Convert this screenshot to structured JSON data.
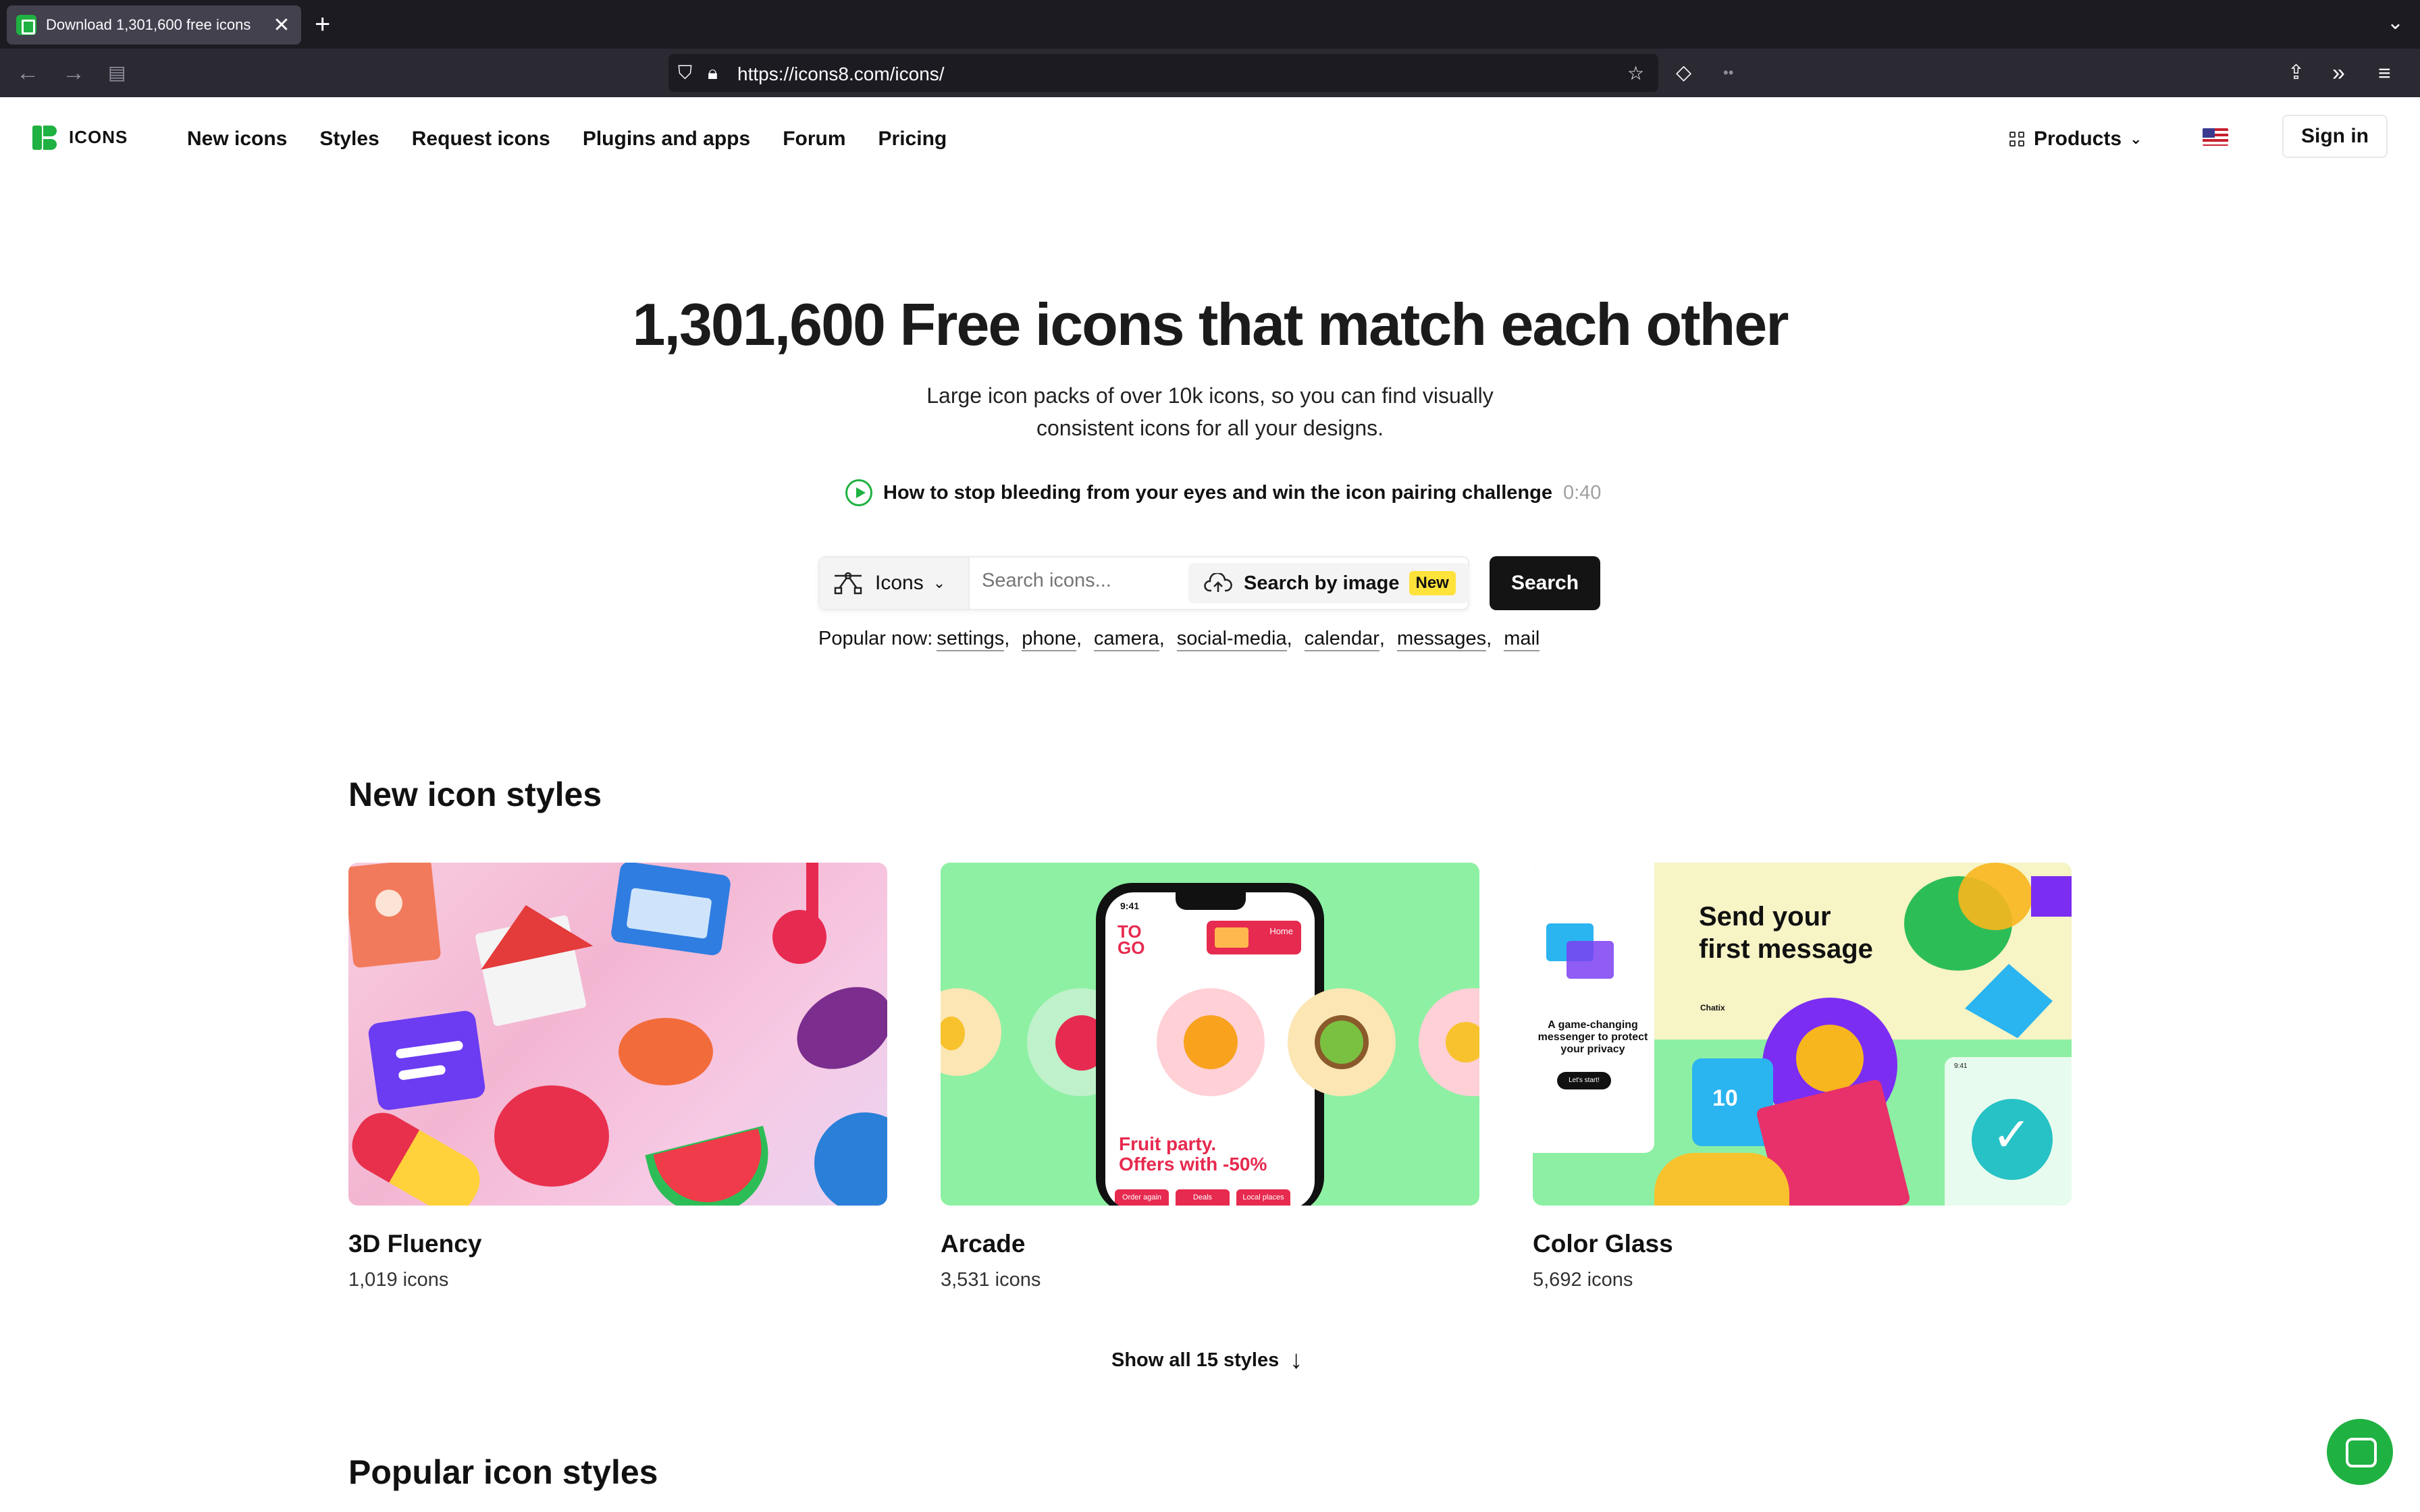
{
  "browser": {
    "tab_title": "Download 1,301,600 free icons",
    "tab_close": "✕",
    "new_tab": "+",
    "url": "https://icons8.com/icons/"
  },
  "header": {
    "logo_text": "ICONS",
    "menu": [
      "New icons",
      "Styles",
      "Request icons",
      "Plugins and apps",
      "Forum",
      "Pricing"
    ],
    "products_label": "Products",
    "signin_label": "Sign in"
  },
  "hero": {
    "title": "1,301,600 Free icons that match each other",
    "subtitle": "Large icon packs of over 10k icons, so you can find visually consistent icons for all your designs.",
    "video_title": "How to stop bleeding from your eyes and win the icon pairing challenge",
    "video_duration": "0:40"
  },
  "search": {
    "type_label": "Icons",
    "placeholder": "Search icons...",
    "by_image_label": "Search by image",
    "new_badge": "New",
    "button_label": "Search",
    "popular_label": "Popular now:",
    "popular_tags": [
      "settings",
      "phone",
      "camera",
      "social-media",
      "calendar",
      "messages",
      "mail"
    ]
  },
  "new_styles": {
    "title": "New icon styles",
    "cards": [
      {
        "name": "3D Fluency",
        "count": "1,019 icons"
      },
      {
        "name": "Arcade",
        "count": "3,531 icons"
      },
      {
        "name": "Color Glass",
        "count": "5,692 icons"
      }
    ],
    "show_all": "Show all 15 styles"
  },
  "arcade_art": {
    "togo": "TO GO",
    "home": "Home",
    "time": "9:41",
    "promo_line1": "Fruit party.",
    "promo_line2": "Offers with -50%",
    "buttons": [
      "Order again",
      "Deals",
      "Local places"
    ]
  },
  "glass_art": {
    "headline_line1": "Send your",
    "headline_line2": "first message",
    "brand": "Chatix",
    "tagline": "A game-changing messenger to protect your privacy",
    "cta": "Let's start!",
    "jersey": "10",
    "time": "9:41"
  },
  "popular_styles": {
    "title": "Popular icon styles"
  },
  "colors": {
    "brand_green": "#1fb141",
    "badge_yellow": "#ffe23a"
  }
}
